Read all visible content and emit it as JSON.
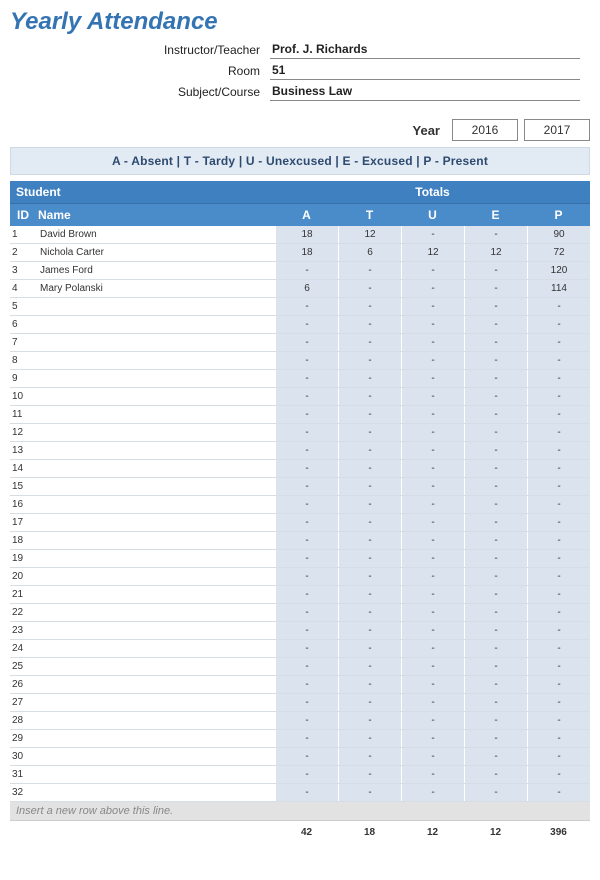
{
  "title": "Yearly Attendance",
  "meta": {
    "instructor_label": "Instructor/Teacher",
    "instructor": "Prof. J. Richards",
    "room_label": "Room",
    "room": "51",
    "subject_label": "Subject/Course",
    "subject": "Business Law"
  },
  "year": {
    "label": "Year",
    "opt1": "2016",
    "opt2": "2017"
  },
  "legend": "A - Absent  |  T - Tardy  |  U - Unexcused  |  E - Excused  |  P - Present",
  "headers": {
    "student": "Student",
    "totals": "Totals",
    "id": "ID",
    "name": "Name",
    "a": "A",
    "t": "T",
    "u": "U",
    "e": "E",
    "p": "P"
  },
  "rows": [
    {
      "id": "1",
      "name": "David Brown",
      "a": "18",
      "t": "12",
      "u": "-",
      "e": "-",
      "p": "90"
    },
    {
      "id": "2",
      "name": "Nichola Carter",
      "a": "18",
      "t": "6",
      "u": "12",
      "e": "12",
      "p": "72"
    },
    {
      "id": "3",
      "name": "James Ford",
      "a": "-",
      "t": "-",
      "u": "-",
      "e": "-",
      "p": "120"
    },
    {
      "id": "4",
      "name": "Mary Polanski",
      "a": "6",
      "t": "-",
      "u": "-",
      "e": "-",
      "p": "114"
    },
    {
      "id": "5",
      "name": "",
      "a": "-",
      "t": "-",
      "u": "-",
      "e": "-",
      "p": "-"
    },
    {
      "id": "6",
      "name": "",
      "a": "-",
      "t": "-",
      "u": "-",
      "e": "-",
      "p": "-"
    },
    {
      "id": "7",
      "name": "",
      "a": "-",
      "t": "-",
      "u": "-",
      "e": "-",
      "p": "-"
    },
    {
      "id": "8",
      "name": "",
      "a": "-",
      "t": "-",
      "u": "-",
      "e": "-",
      "p": "-"
    },
    {
      "id": "9",
      "name": "",
      "a": "-",
      "t": "-",
      "u": "-",
      "e": "-",
      "p": "-"
    },
    {
      "id": "10",
      "name": "",
      "a": "-",
      "t": "-",
      "u": "-",
      "e": "-",
      "p": "-"
    },
    {
      "id": "11",
      "name": "",
      "a": "-",
      "t": "-",
      "u": "-",
      "e": "-",
      "p": "-"
    },
    {
      "id": "12",
      "name": "",
      "a": "-",
      "t": "-",
      "u": "-",
      "e": "-",
      "p": "-"
    },
    {
      "id": "13",
      "name": "",
      "a": "-",
      "t": "-",
      "u": "-",
      "e": "-",
      "p": "-"
    },
    {
      "id": "14",
      "name": "",
      "a": "-",
      "t": "-",
      "u": "-",
      "e": "-",
      "p": "-"
    },
    {
      "id": "15",
      "name": "",
      "a": "-",
      "t": "-",
      "u": "-",
      "e": "-",
      "p": "-"
    },
    {
      "id": "16",
      "name": "",
      "a": "-",
      "t": "-",
      "u": "-",
      "e": "-",
      "p": "-"
    },
    {
      "id": "17",
      "name": "",
      "a": "-",
      "t": "-",
      "u": "-",
      "e": "-",
      "p": "-"
    },
    {
      "id": "18",
      "name": "",
      "a": "-",
      "t": "-",
      "u": "-",
      "e": "-",
      "p": "-"
    },
    {
      "id": "19",
      "name": "",
      "a": "-",
      "t": "-",
      "u": "-",
      "e": "-",
      "p": "-"
    },
    {
      "id": "20",
      "name": "",
      "a": "-",
      "t": "-",
      "u": "-",
      "e": "-",
      "p": "-"
    },
    {
      "id": "21",
      "name": "",
      "a": "-",
      "t": "-",
      "u": "-",
      "e": "-",
      "p": "-"
    },
    {
      "id": "22",
      "name": "",
      "a": "-",
      "t": "-",
      "u": "-",
      "e": "-",
      "p": "-"
    },
    {
      "id": "23",
      "name": "",
      "a": "-",
      "t": "-",
      "u": "-",
      "e": "-",
      "p": "-"
    },
    {
      "id": "24",
      "name": "",
      "a": "-",
      "t": "-",
      "u": "-",
      "e": "-",
      "p": "-"
    },
    {
      "id": "25",
      "name": "",
      "a": "-",
      "t": "-",
      "u": "-",
      "e": "-",
      "p": "-"
    },
    {
      "id": "26",
      "name": "",
      "a": "-",
      "t": "-",
      "u": "-",
      "e": "-",
      "p": "-"
    },
    {
      "id": "27",
      "name": "",
      "a": "-",
      "t": "-",
      "u": "-",
      "e": "-",
      "p": "-"
    },
    {
      "id": "28",
      "name": "",
      "a": "-",
      "t": "-",
      "u": "-",
      "e": "-",
      "p": "-"
    },
    {
      "id": "29",
      "name": "",
      "a": "-",
      "t": "-",
      "u": "-",
      "e": "-",
      "p": "-"
    },
    {
      "id": "30",
      "name": "",
      "a": "-",
      "t": "-",
      "u": "-",
      "e": "-",
      "p": "-"
    },
    {
      "id": "31",
      "name": "",
      "a": "-",
      "t": "-",
      "u": "-",
      "e": "-",
      "p": "-"
    },
    {
      "id": "32",
      "name": "",
      "a": "-",
      "t": "-",
      "u": "-",
      "e": "-",
      "p": "-"
    }
  ],
  "insert_text": "Insert a new row above this line.",
  "totals": {
    "a": "42",
    "t": "18",
    "u": "12",
    "e": "12",
    "p": "396"
  }
}
